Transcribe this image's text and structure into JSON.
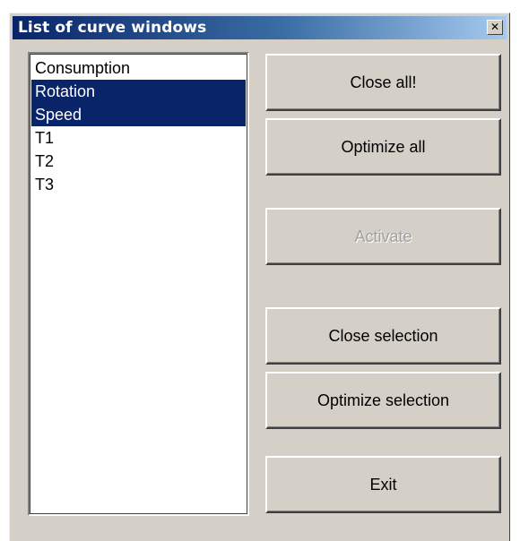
{
  "window": {
    "title": "List of curve windows",
    "close_glyph": "✕",
    "close_icon": "close-icon"
  },
  "curve_list": {
    "items": [
      {
        "label": "Consumption",
        "selected": false
      },
      {
        "label": "Rotation",
        "selected": true
      },
      {
        "label": "Speed",
        "selected": true
      },
      {
        "label": "T1",
        "selected": false
      },
      {
        "label": "T2",
        "selected": false
      },
      {
        "label": "T3",
        "selected": false
      }
    ]
  },
  "buttons": {
    "close_all": "Close all!",
    "optimize_all": "Optimize all",
    "activate": "Activate",
    "close_selection": "Close selection",
    "optimize_selection": "Optimize selection",
    "exit": "Exit"
  },
  "colors": {
    "dialog_face": "#d4d0c8",
    "selection": "#0a246a",
    "title_gradient_start": "#0a246a",
    "title_gradient_end": "#a6caf0",
    "disabled_text": "#a0a0a0"
  }
}
